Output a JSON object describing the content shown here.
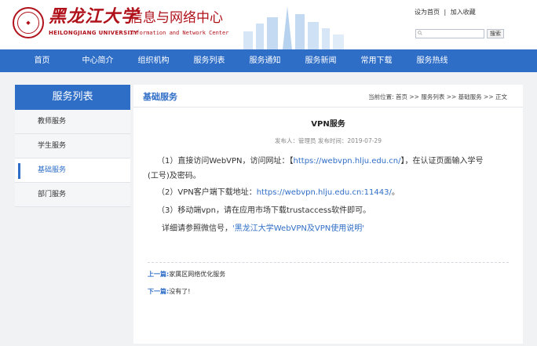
{
  "header": {
    "university_cn": "黑龙江大学",
    "university_en": "HEILONGJIANG UNIVERSITY",
    "center_cn": "信息与网络中心",
    "center_en": "Information and Network Center",
    "set_home": "设为首页",
    "separator": "|",
    "add_fav": "加入收藏",
    "search_placeholder": "",
    "search_button": "搜索"
  },
  "nav": {
    "items": [
      "首页",
      "中心简介",
      "组织机构",
      "服务列表",
      "服务通知",
      "服务新闻",
      "常用下载",
      "服务热线"
    ]
  },
  "sidebar": {
    "title": "服务列表",
    "items": [
      "教师服务",
      "学生服务",
      "基础服务",
      "部门服务"
    ],
    "active_index": 2
  },
  "content": {
    "section_title": "基础服务",
    "breadcrumb": "当前位置: 首页 >> 服务列表 >> 基础服务 >> 正文",
    "article_title": "VPN服务",
    "meta": "发布人：管理员   发布时间：2019-07-29",
    "p1_prefix": "（1）直接访问WebVPN，访问网址：【",
    "p1_link": "https://webvpn.hlju.edu.cn/",
    "p1_suffix": "】，在认证页面输入学号",
    "p1_line2": "(工号)及密码。",
    "p2_prefix": "（2）VPN客户端下载地址：",
    "p2_link": "https://webvpn.hlju.edu.cn:11443/",
    "p2_suffix": "。",
    "p3": "（3）移动端vpn，请在应用市场下载trustaccess软件即可。",
    "p4_prefix": "详细请参照微信号，",
    "p4_link": "'黑龙江大学WebVPN及VPN使用说明'",
    "prev_label": "上一篇:",
    "prev_text": "家属区网络优化服务",
    "next_label": "下一篇:",
    "next_text": "没有了!"
  },
  "colors": {
    "brand_red": "#b0121b",
    "nav_blue": "#2f6ec7",
    "background": "#f1f2f4"
  }
}
